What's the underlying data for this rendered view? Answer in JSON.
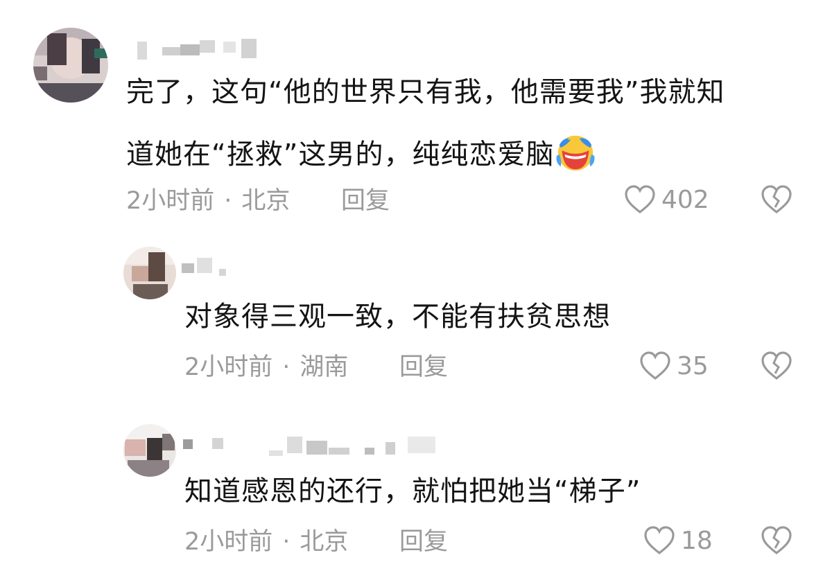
{
  "comments": [
    {
      "text_line1": "完了，这句“他的世界只有我，他需要我”我就知",
      "text_line2": "道她在“拯救”这男的，纯纯恋爱脑",
      "emoji": "laughing-crying-emoji",
      "time": "2小时前",
      "separator": "·",
      "location": "北京",
      "reply_label": "回复",
      "likes": "402"
    },
    {
      "text": "对象得三观一致，不能有扶贫思想",
      "time": "2小时前",
      "separator": "·",
      "location": "湖南",
      "reply_label": "回复",
      "likes": "35"
    },
    {
      "text": "知道感恩的还行，就怕把她当“梯子”",
      "time": "2小时前",
      "separator": "·",
      "location": "北京",
      "reply_label": "回复",
      "likes": "18"
    }
  ],
  "icons": {
    "like": "heart-outline-icon",
    "dislike": "broken-heart-icon"
  },
  "colors": {
    "text": "#141414",
    "meta": "#9a9a9a",
    "background": "#ffffff"
  }
}
